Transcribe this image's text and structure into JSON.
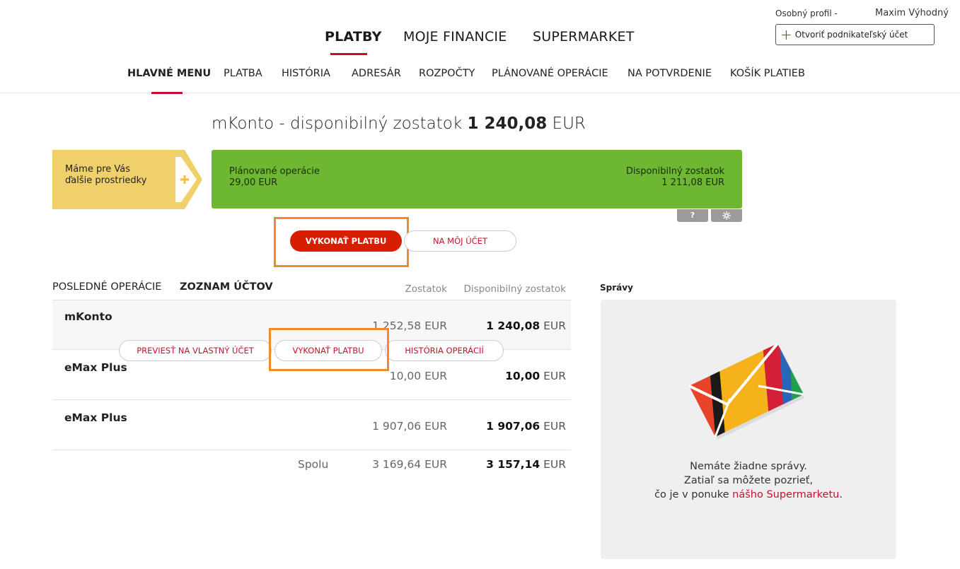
{
  "header": {
    "profile_label": "Osobný profil",
    "profile_separator": "-",
    "user_name": "Maxim Výhodný",
    "business_button": "Otvoriť podnikateľský účet"
  },
  "main_nav": [
    {
      "label": "PLATBY",
      "active": true
    },
    {
      "label": "MOJE FINANCIE",
      "active": false
    },
    {
      "label": "SUPERMARKET",
      "active": false
    }
  ],
  "sub_nav": [
    {
      "label": "HLAVNÉ MENU",
      "active": true
    },
    {
      "label": "PLATBA"
    },
    {
      "label": "HISTÓRIA"
    },
    {
      "label": "ADRESÁR"
    },
    {
      "label": "ROZPOČTY"
    },
    {
      "label": "PLÁNOVANÉ OPERÁCIE"
    },
    {
      "label": "NA POTVRDENIE"
    },
    {
      "label": "KOŠÍK PLATIEB"
    }
  ],
  "balance": {
    "prefix": "mKonto - disponibilný zostatok",
    "amount": "1 240,08",
    "currency": "EUR"
  },
  "promo": {
    "text": "Máme pre Vás ďalšie prostriedky",
    "arrow_icon": "plus-icon"
  },
  "summary_bar": {
    "planned_label": "Plánované operácie",
    "planned_value": "29,00 EUR",
    "available_label": "Disponibilný zostatok",
    "available_value": "1 211,08 EUR",
    "help_label": "?",
    "settings_icon": "gear-icon",
    "color": "#6db733"
  },
  "actions": {
    "make_payment": "VYKONAŤ PLATBU",
    "to_my_account": "NA MÔJ ÚČET"
  },
  "accounts_tabs": {
    "recent": "POSLEDNÉ OPERÁCIE",
    "list": "ZOZNAM ÚČTOV"
  },
  "table": {
    "col_balance": "Zostatok",
    "col_available": "Disponibilný zostatok",
    "rows": [
      {
        "name": "mKonto",
        "balance": "1 252,58 EUR",
        "available_amount": "1 240,08",
        "available_currency": "EUR"
      },
      {
        "name": "eMax Plus",
        "balance": "10,00 EUR",
        "available_amount": "10,00",
        "available_currency": "EUR"
      },
      {
        "name": "eMax Plus",
        "balance": "1 907,06 EUR",
        "available_amount": "1 907,06",
        "available_currency": "EUR"
      }
    ],
    "total_label": "Spolu",
    "total_balance": "3 169,64 EUR",
    "total_available_amount": "3 157,14",
    "total_available_currency": "EUR",
    "row_actions": {
      "transfer_own": "PREVIESŤ NA VLASTNÝ ÚČET",
      "make_payment": "VYKONAŤ PLATBU",
      "history": "HISTÓRIA OPERÁCIÍ"
    }
  },
  "messages": {
    "title": "Správy",
    "line1": "Nemáte žiadne správy.",
    "line2": "Zatiaľ sa môžete pozrieť,",
    "line3_prefix": "čo je v ponuke ",
    "line3_link": "nášho Supermarketu",
    "line3_suffix": ".",
    "envelope_icon": "envelope-icon"
  },
  "colors": {
    "brand_red": "#c8102e",
    "button_red": "#d71f00",
    "highlight_orange": "#f08a2c",
    "promo_yellow": "#f0d06a"
  }
}
